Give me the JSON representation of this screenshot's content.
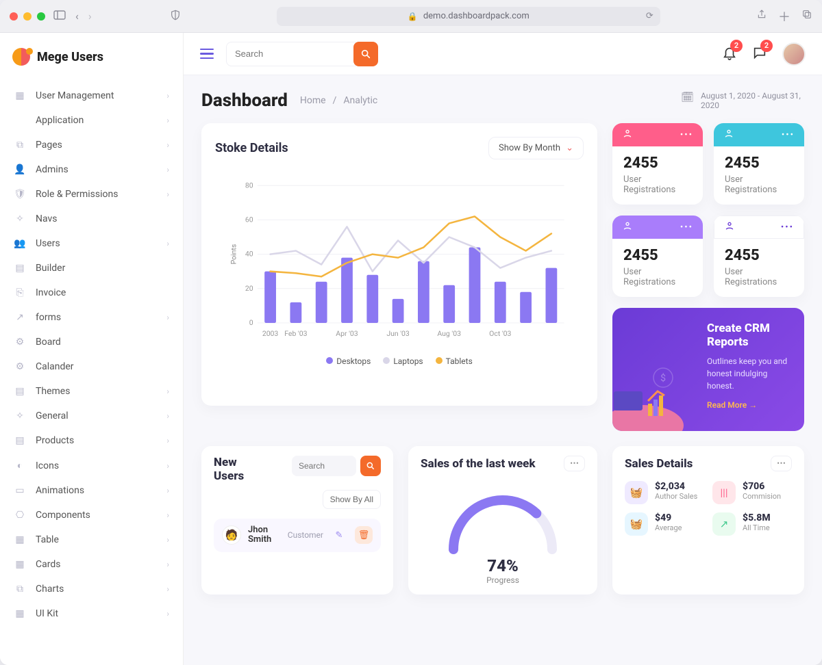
{
  "browser": {
    "url": "demo.dashboardpack.com"
  },
  "brand": "Mege Users",
  "sidebar": {
    "items": [
      {
        "label": "User Management",
        "has_children": true
      },
      {
        "label": "Application",
        "has_children": true
      },
      {
        "label": "Pages",
        "has_children": true
      },
      {
        "label": "Admins",
        "has_children": true
      },
      {
        "label": "Role & Permissions",
        "has_children": true
      },
      {
        "label": "Navs",
        "has_children": false
      },
      {
        "label": "Users",
        "has_children": true
      },
      {
        "label": "Builder",
        "has_children": false
      },
      {
        "label": "Invoice",
        "has_children": false
      },
      {
        "label": "forms",
        "has_children": true
      },
      {
        "label": "Board",
        "has_children": false
      },
      {
        "label": "Calander",
        "has_children": false
      },
      {
        "label": "Themes",
        "has_children": true
      },
      {
        "label": "General",
        "has_children": true
      },
      {
        "label": "Products",
        "has_children": true
      },
      {
        "label": "Icons",
        "has_children": true
      },
      {
        "label": "Animations",
        "has_children": true
      },
      {
        "label": "Components",
        "has_children": true
      },
      {
        "label": "Table",
        "has_children": true
      },
      {
        "label": "Cards",
        "has_children": true
      },
      {
        "label": "Charts",
        "has_children": true
      },
      {
        "label": "UI Kit",
        "has_children": true
      }
    ]
  },
  "topbar": {
    "search_placeholder": "Search",
    "bell_count": "2",
    "chat_count": "2"
  },
  "page": {
    "title": "Dashboard",
    "crumb_home": "Home",
    "crumb_sep": "/",
    "crumb_current": "Analytic",
    "date_range": "August 1, 2020 - August 31, 2020"
  },
  "stoke": {
    "title": "Stoke Details",
    "filter_label": "Show By Month",
    "legend": [
      "Desktops",
      "Laptops",
      "Tablets"
    ],
    "y_title": "Points"
  },
  "chart_data": {
    "type": "bar",
    "title": "Stoke Details",
    "ylabel": "Points",
    "ylim": [
      0,
      80
    ],
    "y_ticks": [
      0,
      20,
      40,
      60,
      80
    ],
    "categories": [
      "2003",
      "Feb '03",
      "",
      "Apr '03",
      "",
      "Jun '03",
      "",
      "Aug '03",
      "",
      "Oct '03",
      "",
      ""
    ],
    "series": [
      {
        "name": "Desktops",
        "type": "bar",
        "color": "#8b78f2",
        "values": [
          30,
          12,
          24,
          38,
          28,
          14,
          36,
          22,
          44,
          24,
          18,
          32
        ]
      },
      {
        "name": "Laptops",
        "type": "line",
        "color": "#d9d6e8",
        "values": [
          40,
          42,
          34,
          56,
          30,
          48,
          35,
          50,
          44,
          32,
          38,
          42
        ]
      },
      {
        "name": "Tablets",
        "type": "line",
        "color": "#f4b53f",
        "values": [
          30,
          29,
          27,
          35,
          40,
          38,
          44,
          58,
          62,
          50,
          42,
          52
        ]
      }
    ]
  },
  "stats": [
    {
      "color": "#ff5e8a",
      "value": "2455",
      "label": "User Registrations"
    },
    {
      "color": "#3ec6dd",
      "value": "2455",
      "label": "User Registrations"
    },
    {
      "color": "#a97dfb",
      "value": "2455",
      "label": "User Registrations"
    },
    {
      "color": "#ffffff",
      "value": "2455",
      "label": "User Registrations",
      "icon_tint": "#6b3bd6",
      "border": true
    }
  ],
  "crm": {
    "title": "Create CRM Reports",
    "desc": "Outlines keep you and honest indulging honest.",
    "link": "Read More"
  },
  "new_users": {
    "title": "New Users",
    "search_placeholder": "Search",
    "show_all": "Show By All",
    "rows": [
      {
        "name": "Jhon Smith",
        "role": "Customer"
      }
    ]
  },
  "sales_week": {
    "title": "Sales of the last week",
    "value": "74%",
    "label": "Progress",
    "pct": 74
  },
  "sales_details": {
    "title": "Sales Details",
    "items": [
      {
        "val": "$2,034",
        "lbl": "Author Sales",
        "bg": "#efeaff",
        "tint": "#6b3bd6"
      },
      {
        "val": "$706",
        "lbl": "Commision",
        "bg": "#ffe6ea",
        "tint": "#ff5e8a"
      },
      {
        "val": "$49",
        "lbl": "Average",
        "bg": "#e6f6ff",
        "tint": "#3ec6dd"
      },
      {
        "val": "$5.8M",
        "lbl": "All Time",
        "bg": "#e9fbef",
        "tint": "#3ec98c"
      }
    ]
  }
}
